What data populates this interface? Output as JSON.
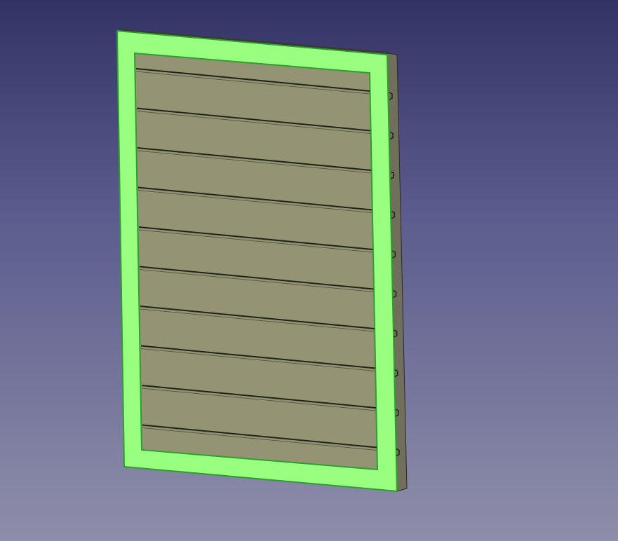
{
  "viewport": {
    "background_top": "#333366",
    "background_bottom": "#8e8eaa"
  },
  "model": {
    "name": "louver-window",
    "slat_count": 10,
    "frame_color": "#99ff80",
    "frame_edge_color": "#2f9e2f",
    "panel_color": "#949475",
    "slat_line_color": "#1e2419",
    "side_color": "#6f6f5c"
  }
}
